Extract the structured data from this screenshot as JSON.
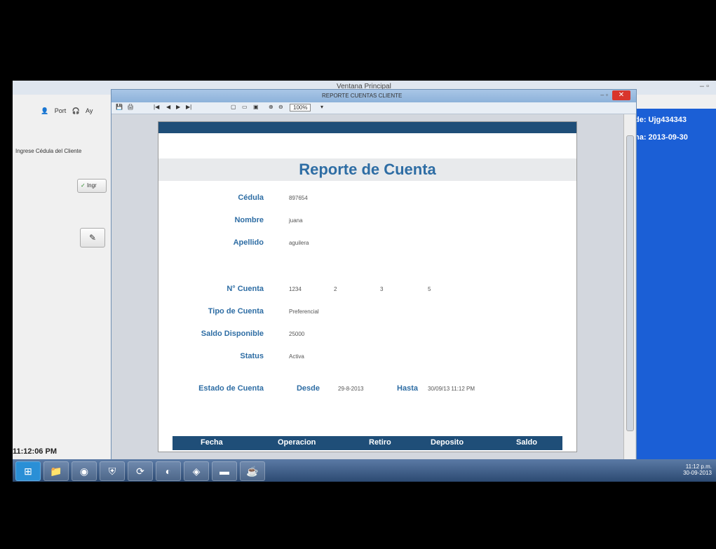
{
  "main_window": {
    "title": "Ventana Principal",
    "toolbar": [
      "Port",
      "Ay"
    ],
    "ingrese_label": "Ingrese Cédula del Cliente",
    "btn_ingresar": "Ingr",
    "clock": "11:12:06 PM",
    "right_info": [
      "de:  Ujg434343",
      "ha:  2013-09-30"
    ]
  },
  "viewer": {
    "title": "REPORTE CUENTAS CLIENTE",
    "zoom": "100%",
    "report": {
      "heading": "Reporte de Cuenta",
      "fields": [
        {
          "label": "Cédula",
          "value": "897654"
        },
        {
          "label": "Nombre",
          "value": "juana"
        },
        {
          "label": "Apellido",
          "value": "aguilera"
        }
      ],
      "cuenta_label": "N° Cuenta",
      "cuenta_values": [
        "1234",
        "2",
        "3",
        "5"
      ],
      "fields2": [
        {
          "label": "Tipo de Cuenta",
          "value": "Preferencial"
        },
        {
          "label": "Saldo Disponible",
          "value": "25000"
        },
        {
          "label": "Status",
          "value": "Activa"
        }
      ],
      "estado_label": "Estado de Cuenta",
      "desde_label": "Desde",
      "desde_value": "29-8-2013",
      "hasta_label": "Hasta",
      "hasta_value": "30/09/13 11:12 PM",
      "table_columns": [
        "Fecha",
        "Operacion",
        "Retiro",
        "Deposito",
        "Saldo"
      ]
    }
  },
  "taskbar": {
    "tray_time": "11:12 p.m.",
    "tray_date": "30-09-2013"
  }
}
